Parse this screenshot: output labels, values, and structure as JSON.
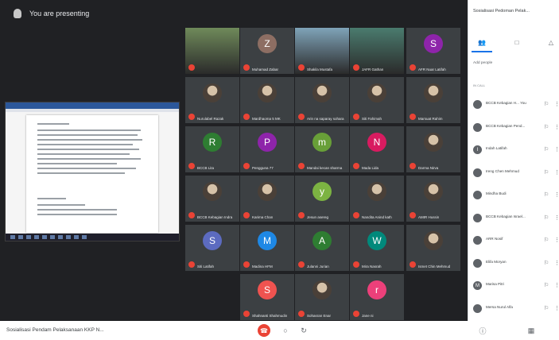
{
  "presenting": {
    "label": "You are presenting"
  },
  "meeting": {
    "title": "Sosialisasi Pendam Pelaksanaan KKP N..."
  },
  "side_panel": {
    "title": "Sosialisasi Pedoman Pelak...",
    "add_people": "Add people",
    "in_call": "IN CALL",
    "participants": [
      {
        "name": "BCCB Kebagian H... You",
        "initial": ""
      },
      {
        "name": "BCCB Kebagian Pend...",
        "initial": ""
      },
      {
        "name": "Indah Latifah",
        "initial": "I"
      },
      {
        "name": "Ireng Chen Mehmud",
        "initial": ""
      },
      {
        "name": "Mindha Budi",
        "initial": ""
      },
      {
        "name": "BCCB Kebagian Israel...",
        "initial": ""
      },
      {
        "name": "ARR Nosif",
        "initial": ""
      },
      {
        "name": "Elifa Moryan",
        "initial": ""
      },
      {
        "name": "Marisa Pitri",
        "initial": "M"
      },
      {
        "name": "Mersa Nurul Alfa",
        "initial": ""
      }
    ]
  },
  "tiles": [
    {
      "name": "",
      "initial": "",
      "kind": "video",
      "color": "#6f8a5a"
    },
    {
      "name": "Muhamad Zabar",
      "initial": "Z",
      "kind": "letter",
      "color": "#8d6e63"
    },
    {
      "name": "Shakila Mustafa",
      "initial": "",
      "kind": "video",
      "color": "#7fa3b8"
    },
    {
      "name": "JAFR Gathan",
      "initial": "",
      "kind": "video",
      "color": "#4a7b6e"
    },
    {
      "name": "AFR Nuar Latifah",
      "initial": "S",
      "kind": "letter",
      "color": "#8e24aa"
    },
    {
      "name": "Nurulabel Razak",
      "initial": "",
      "kind": "photo",
      "color": ""
    },
    {
      "name": "Mardhaoma 5 MK",
      "initial": "",
      "kind": "photo",
      "color": ""
    },
    {
      "name": "Arin na saparay sohara",
      "initial": "",
      "kind": "photo",
      "color": ""
    },
    {
      "name": "Siti Fahimah",
      "initial": "",
      "kind": "photo",
      "color": ""
    },
    {
      "name": "Marsuat Rahim",
      "initial": "",
      "kind": "photo",
      "color": ""
    },
    {
      "name": "BCCB Lita",
      "initial": "R",
      "kind": "letter",
      "color": "#2e7d32"
    },
    {
      "name": "Pengguna 77",
      "initial": "P",
      "kind": "letter",
      "color": "#8e24aa"
    },
    {
      "name": "Mandai kecan sharma",
      "initial": "m",
      "kind": "letter",
      "color": "#689f38"
    },
    {
      "name": "Mada Lida",
      "initial": "N",
      "kind": "letter",
      "color": "#d81b60"
    },
    {
      "name": "Darma Nirva",
      "initial": "",
      "kind": "photo",
      "color": ""
    },
    {
      "name": "BCCB Kebagian Indra",
      "initial": "",
      "kind": "photo",
      "color": ""
    },
    {
      "name": "Karima Chan",
      "initial": "",
      "kind": "photo",
      "color": ""
    },
    {
      "name": "Jesun asereg",
      "initial": "y",
      "kind": "letter",
      "color": "#7cb342"
    },
    {
      "name": "Nandita Anind kath",
      "initial": "",
      "kind": "photo",
      "color": ""
    },
    {
      "name": "AMIR Hussin",
      "initial": "",
      "kind": "photo",
      "color": ""
    },
    {
      "name": "Siti Latifah",
      "initial": "S",
      "kind": "letter",
      "color": "#5c6bc0"
    },
    {
      "name": "Madina HFM",
      "initial": "M",
      "kind": "letter",
      "color": "#1e88e5"
    },
    {
      "name": "Julanni Jurian",
      "initial": "A",
      "kind": "letter",
      "color": "#2e7d32"
    },
    {
      "name": "Mira Nasrah",
      "initial": "W",
      "kind": "letter",
      "color": "#00897b"
    },
    {
      "name": "Ismet Chin Mehmud",
      "initial": "",
      "kind": "photo",
      "color": ""
    },
    {
      "name": "Shahnanti Shahmudin",
      "initial": "S",
      "kind": "letter",
      "color": "#ef5350"
    },
    {
      "name": "Sohasran Enar",
      "initial": "",
      "kind": "photo",
      "color": ""
    },
    {
      "name": "Jane ni",
      "initial": "r",
      "kind": "letter",
      "color": "#ec407a"
    }
  ]
}
